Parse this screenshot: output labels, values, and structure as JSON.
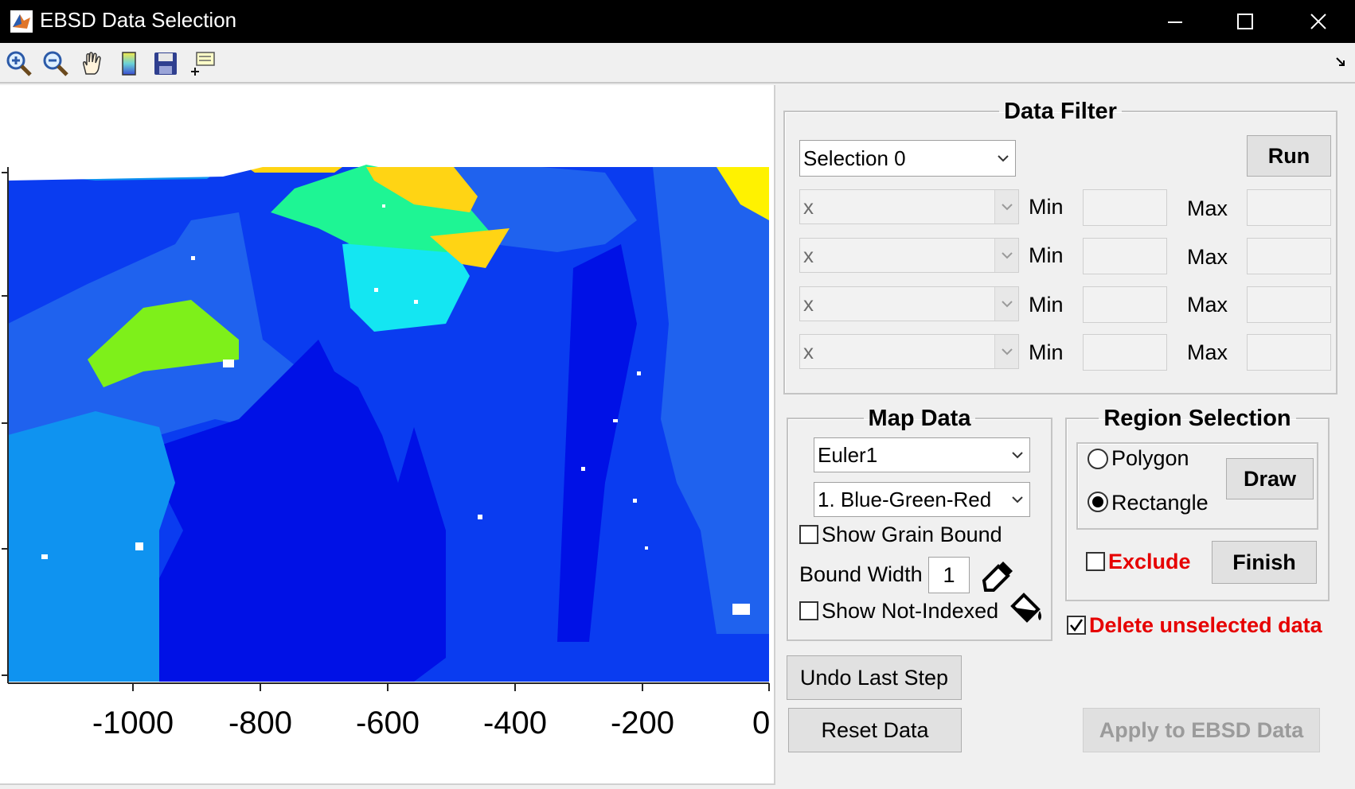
{
  "window": {
    "title": "EBSD Data Selection"
  },
  "toolbar": {
    "tools": [
      "zoom-in-icon",
      "zoom-out-icon",
      "pan-hand-icon",
      "colorbar-icon",
      "save-icon",
      "data-cursor-icon"
    ]
  },
  "plot": {
    "xtick_labels": [
      "-1000",
      "-800",
      "-600",
      "-400",
      "-200",
      "0"
    ],
    "colors": {
      "deep_blue": "#0011e6",
      "mid_blue": "#0a3cf0",
      "blue": "#1f62ee",
      "light_blue": "#0f93f0",
      "cyan": "#14e6f2",
      "teal_green": "#1ef594",
      "lime": "#7ef01a",
      "yellow": "#ffd414",
      "yellow_bright": "#fff200"
    }
  },
  "data_filter": {
    "legend": "Data Filter",
    "selection_value": "Selection 0",
    "run_label": "Run",
    "rows": [
      {
        "field": "x",
        "min_label": "Min",
        "max_label": "Max"
      },
      {
        "field": "x",
        "min_label": "Min",
        "max_label": "Max"
      },
      {
        "field": "x",
        "min_label": "Min",
        "max_label": "Max"
      },
      {
        "field": "x",
        "min_label": "Min",
        "max_label": "Max"
      }
    ]
  },
  "map_data": {
    "legend": "Map Data",
    "data_value": "Euler1",
    "colormap_value": "1. Blue-Green-Red",
    "show_grain_bound_label": "Show Grain Bound",
    "show_grain_bound_checked": false,
    "bound_width_label": "Bound Width",
    "bound_width_value": "1",
    "show_not_indexed_label": "Show Not-Indexed",
    "show_not_indexed_checked": false
  },
  "region_selection": {
    "legend": "Region Selection",
    "polygon_label": "Polygon",
    "rectangle_label": "Rectangle",
    "selected": "Rectangle",
    "draw_label": "Draw",
    "exclude_label": "Exclude",
    "exclude_checked": false,
    "finish_label": "Finish"
  },
  "delete_unselected": {
    "label": "Delete unselected data",
    "checked": true
  },
  "buttons": {
    "undo_label": "Undo Last Step",
    "reset_label": "Reset Data",
    "apply_label": "Apply to EBSD Data"
  }
}
